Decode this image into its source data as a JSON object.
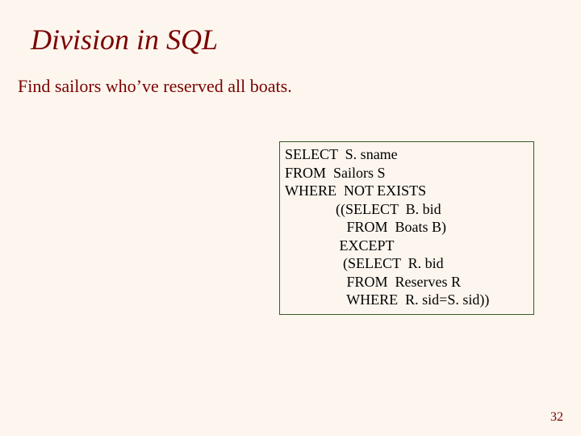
{
  "title": "Division in SQL",
  "subtitle": "Find sailors who’ve reserved all boats.",
  "sql": {
    "l1_kw": "SELECT",
    "l1_rest": "  S. sname",
    "l2_kw": "FROM",
    "l2_rest": "  Sailors S",
    "l3_kw": "WHERE  NOT EXISTS",
    "l4_pre": "              ((",
    "l4_kw": "SELECT",
    "l4_rest": "  B. bid",
    "l5_pre": "                 ",
    "l5_kw": "FROM",
    "l5_rest": "  Boats B)",
    "l6_pre": "               ",
    "l6_kw": "EXCEPT",
    "l7_pre": "                (",
    "l7_kw": "SELECT",
    "l7_rest": "  R. bid",
    "l8_pre": "                 ",
    "l8_kw": "FROM",
    "l8_rest": "  Reserves R",
    "l9_pre": "                 ",
    "l9_kw": "WHERE",
    "l9_rest": "  R. sid=S. sid))"
  },
  "page_number": "32"
}
